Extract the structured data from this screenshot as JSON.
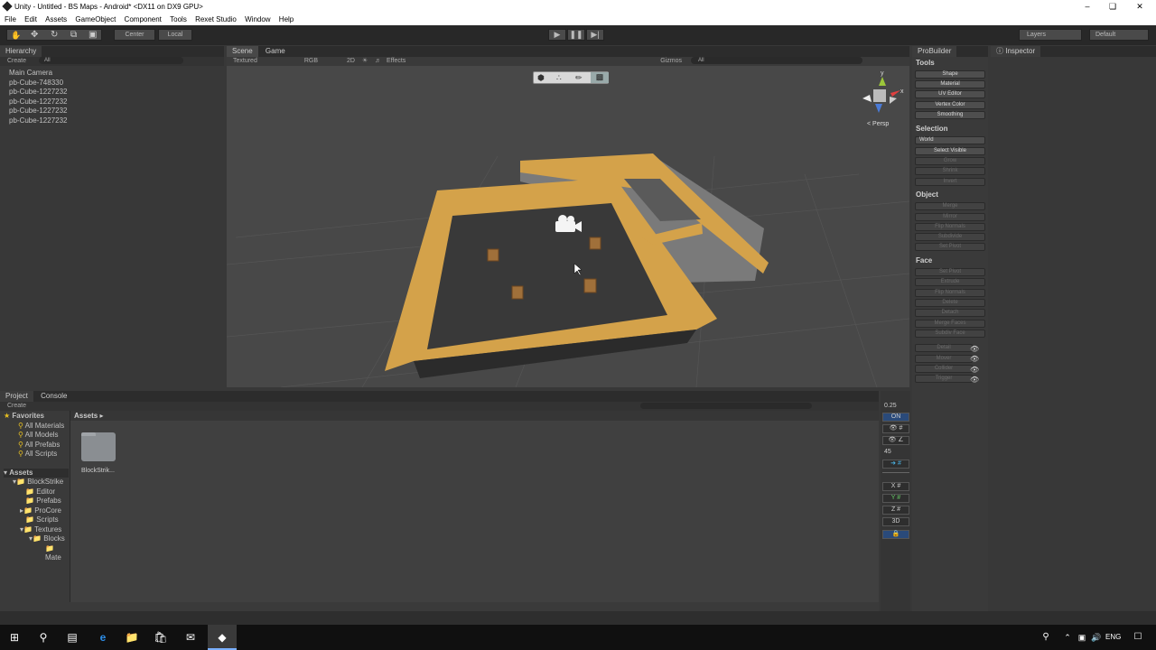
{
  "window": {
    "title": "Unity - Untitled - BS Maps - Android* <DX11 on DX9 GPU>"
  },
  "menu": [
    "File",
    "Edit",
    "Assets",
    "GameObject",
    "Component",
    "Tools",
    "Rexet Studio",
    "Window",
    "Help"
  ],
  "toolbar": {
    "center": "Center",
    "local": "Local",
    "layers": "Layers",
    "layout": "Default"
  },
  "hierarchy": {
    "tab": "Hierarchy",
    "create": "Create",
    "search_placeholder": "All",
    "items": [
      "Main Camera",
      "pb-Cube-748330",
      "pb-Cube-1227232",
      "pb-Cube-1227232",
      "pb-Cube-1227232",
      "pb-Cube-1227232"
    ]
  },
  "scene": {
    "tab_scene": "Scene",
    "tab_game": "Game",
    "shading": "Textured",
    "rgb": "RGB",
    "mode2d": "2D",
    "effects": "Effects",
    "gizmos": "Gizmos",
    "search_placeholder": "All",
    "persp": "< Persp",
    "gizmo_x": "x",
    "gizmo_y": "y"
  },
  "probuilder": {
    "tab": "ProBuilder",
    "tools_label": "Tools",
    "tools": [
      "Shape",
      "Material",
      "UV Editor",
      "Vertex Color",
      "Smoothing"
    ],
    "selection_label": "Selection",
    "selection": [
      "World",
      "Select Visible",
      "Grow",
      "Shrink",
      "Invert"
    ],
    "object_label": "Object",
    "object": [
      "Merge",
      "Mirror",
      "Flip Normals",
      "Subdivide",
      "Set Pivot"
    ],
    "face_label": "Face",
    "face": [
      "Set Pivot",
      "Extrude",
      "Flip Normals",
      "Delete",
      "Detach",
      "Merge Faces",
      "Subdiv Face"
    ],
    "entity": [
      "Detail",
      "Mover",
      "Collider",
      "Trigger"
    ]
  },
  "inspector": {
    "tab": "Inspector"
  },
  "project": {
    "tab_project": "Project",
    "tab_console": "Console",
    "create": "Create",
    "favorites_label": "Favorites",
    "favorites": [
      "All Materials",
      "All Models",
      "All Prefabs",
      "All Scripts"
    ],
    "assets_label": "Assets",
    "folders": [
      "BlockStrike",
      "Editor",
      "Prefabs",
      "ProCore",
      "Scripts",
      "Textures",
      "Blocks",
      "Mate"
    ],
    "breadcrumb": "Assets",
    "asset_name": "BlockStrik..."
  },
  "progrids": {
    "snap": "0.25",
    "on": "ON",
    "angle": "45",
    "x": "X",
    "y": "Y",
    "z": "Z",
    "mode3d": "3D"
  },
  "taskbar": {
    "lang": "ENG"
  },
  "colors": {
    "wall": "#d4a24a",
    "floor": "#3a3a3a",
    "grey": "#8a8a8a"
  }
}
